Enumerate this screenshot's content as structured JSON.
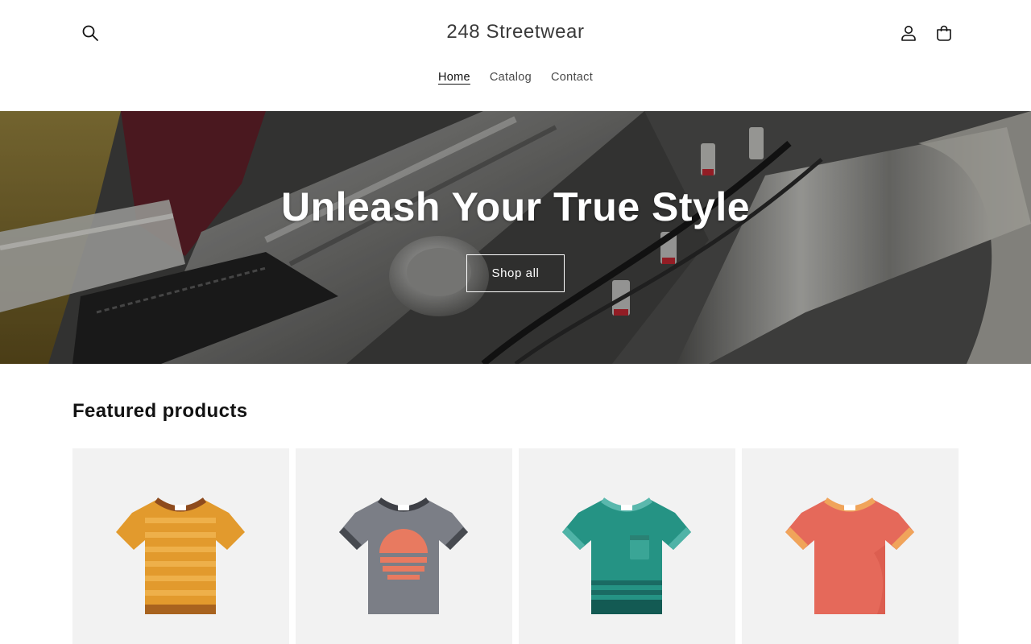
{
  "header": {
    "logo": "248 Streetwear",
    "icons": {
      "search": "search-icon",
      "account": "account-icon",
      "cart": "cart-icon"
    },
    "nav": [
      {
        "label": "Home",
        "active": true
      },
      {
        "label": "Catalog",
        "active": false
      },
      {
        "label": "Contact",
        "active": false
      }
    ]
  },
  "hero": {
    "title": "Unleash Your True Style",
    "button_label": "Shop all"
  },
  "featured": {
    "title": "Featured products",
    "products": [
      {
        "image": "striped-orange-tshirt",
        "color": "#e29a2d"
      },
      {
        "image": "gray-tshirt-with-sunset-graphic",
        "color": "#7b7e86"
      },
      {
        "image": "teal-tshirt-with-pocket",
        "color": "#259384"
      },
      {
        "image": "coral-tshirt",
        "color": "#e5695a"
      }
    ]
  }
}
